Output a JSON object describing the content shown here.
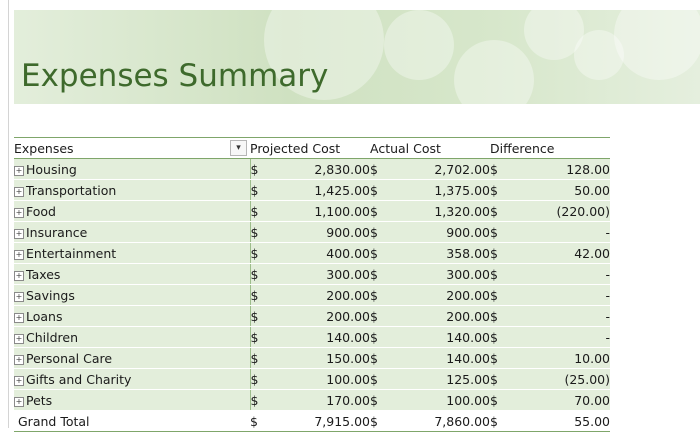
{
  "title": "Expenses Summary",
  "colors": {
    "banner": "#d3e4c7",
    "title": "#3e6a2c",
    "row": "#e3eedb",
    "rule": "#7fa66a"
  },
  "icons": {
    "filter": "filter-dropdown-icon",
    "expand": "expand-plus-icon"
  },
  "headers": {
    "expenses": "Expenses",
    "projected": "Projected Cost",
    "actual": "Actual Cost",
    "difference": "Difference"
  },
  "currency": "$",
  "expand_glyph": "+",
  "filter_glyph": "▾",
  "rows": [
    {
      "name": "Housing",
      "projected": "2,830.00",
      "actual": "2,702.00",
      "difference": "128.00"
    },
    {
      "name": "Transportation",
      "projected": "1,425.00",
      "actual": "1,375.00",
      "difference": "50.00"
    },
    {
      "name": "Food",
      "projected": "1,100.00",
      "actual": "1,320.00",
      "difference": "(220.00)"
    },
    {
      "name": "Insurance",
      "projected": "900.00",
      "actual": "900.00",
      "difference": "-"
    },
    {
      "name": "Entertainment",
      "projected": "400.00",
      "actual": "358.00",
      "difference": "42.00"
    },
    {
      "name": "Taxes",
      "projected": "300.00",
      "actual": "300.00",
      "difference": "-"
    },
    {
      "name": "Savings",
      "projected": "200.00",
      "actual": "200.00",
      "difference": "-"
    },
    {
      "name": "Loans",
      "projected": "200.00",
      "actual": "200.00",
      "difference": "-"
    },
    {
      "name": "Children",
      "projected": "140.00",
      "actual": "140.00",
      "difference": "-"
    },
    {
      "name": "Personal Care",
      "projected": "150.00",
      "actual": "140.00",
      "difference": "10.00"
    },
    {
      "name": "Gifts and Charity",
      "projected": "100.00",
      "actual": "125.00",
      "difference": "(25.00)"
    },
    {
      "name": "Pets",
      "projected": "170.00",
      "actual": "100.00",
      "difference": "70.00"
    }
  ],
  "total": {
    "label": "Grand Total",
    "projected": "7,915.00",
    "actual": "7,860.00",
    "difference": "55.00"
  }
}
